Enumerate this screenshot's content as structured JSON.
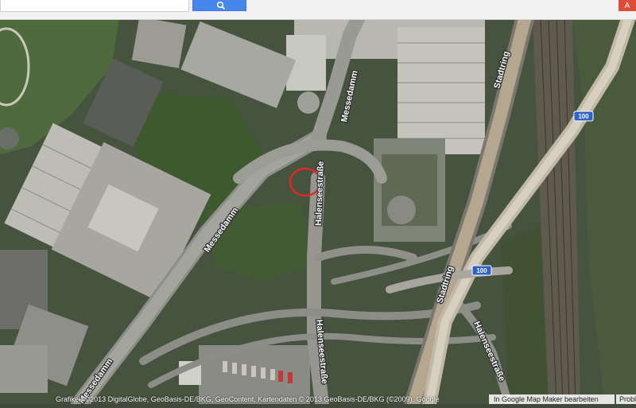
{
  "search": {
    "value": "",
    "placeholder": ""
  },
  "toolbar": {
    "search_icon": "magnifier-icon",
    "account_label": "A"
  },
  "map": {
    "view": "satellite",
    "labels": {
      "messedamm_upper": "Messedamm",
      "messedamm_mid": "Messedamm",
      "messedamm_lower": "Messedamm",
      "stadtring_upper": "Stadtring",
      "stadtring_lower": "Stadtring",
      "halenseestrasse_1": "Halenseestraße",
      "halenseestrasse_2": "Halenseestraße",
      "halenseestrasse_3": "Halenseestraße"
    },
    "shields": {
      "a100_upper": "100",
      "a100_lower": "100"
    },
    "marker": {
      "type": "red-circle",
      "color": "#e32626"
    },
    "colors": {
      "shield": "#2e63c9"
    }
  },
  "footer": {
    "copyright": "Grafiken ©2013 DigitalGlobe, GeoBasis-DE/BKG, GeoContent, Kartendaten © 2013 GeoBasis-DE/BKG (©2009), Google",
    "mapmaker": "In Google Map Maker bearbeiten",
    "problem": "Problem melden"
  }
}
